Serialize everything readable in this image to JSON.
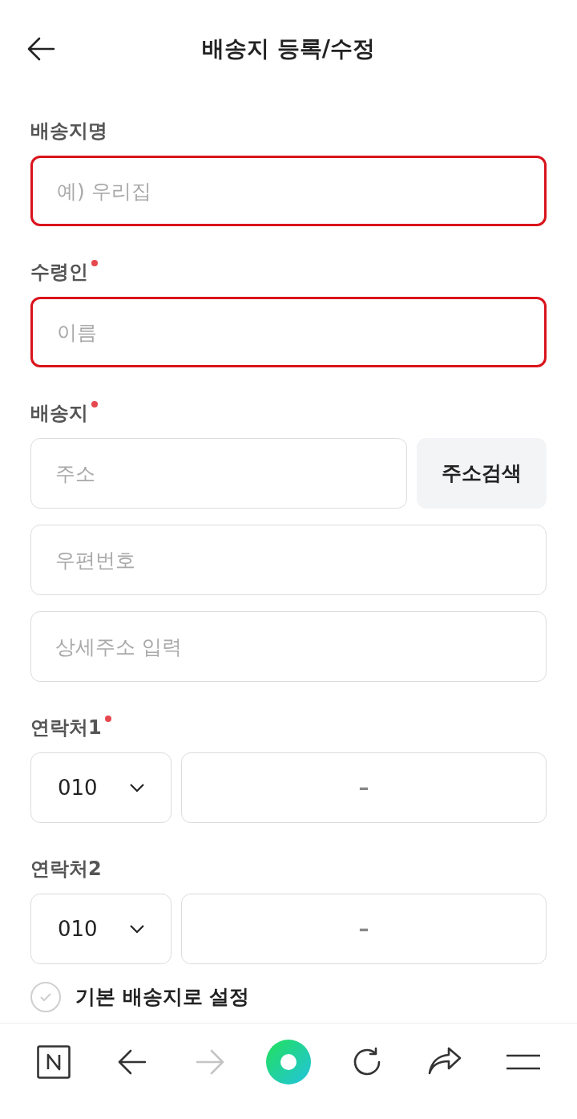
{
  "header": {
    "title": "배송지 등록/수정"
  },
  "sections": [
    {
      "kind": "text",
      "label": "배송지명",
      "required": false,
      "fields": [
        {
          "placeholder": "예) 우리집",
          "highlighted": true
        }
      ]
    },
    {
      "kind": "text",
      "label": "수령인",
      "required": true,
      "fields": [
        {
          "placeholder": "이름",
          "highlighted": true
        }
      ]
    },
    {
      "kind": "address",
      "label": "배송지",
      "required": true,
      "fields": [
        {
          "placeholder": "주소",
          "highlighted": false
        },
        {
          "placeholder": "우편번호",
          "highlighted": false
        },
        {
          "placeholder": "상세주소 입력",
          "highlighted": false
        }
      ],
      "button": "주소검색"
    },
    {
      "kind": "phone",
      "label": "연락처1",
      "required": true,
      "prefix": "010",
      "separator": "–"
    },
    {
      "kind": "phone",
      "label": "연락처2",
      "required": false,
      "prefix": "010",
      "separator": "–"
    }
  ],
  "default_option": {
    "label": "기본 배송지로 설정",
    "checked": false
  },
  "toolbar": [
    {
      "kind": "home"
    },
    {
      "kind": "back",
      "disabled": false
    },
    {
      "kind": "forward",
      "disabled": true
    },
    {
      "kind": "green-dot"
    },
    {
      "kind": "reload"
    },
    {
      "kind": "share"
    },
    {
      "kind": "menu"
    }
  ]
}
